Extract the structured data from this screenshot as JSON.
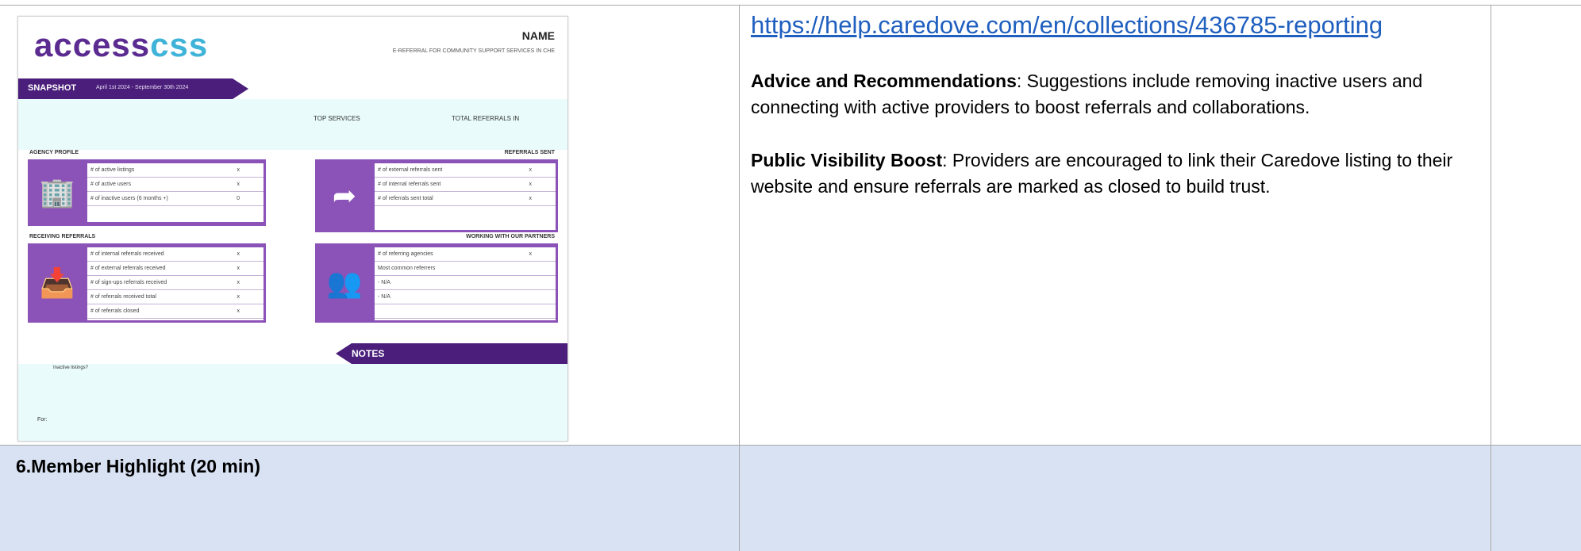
{
  "link": "https://help.caredove.com/en/collections/436785-reporting",
  "advice": {
    "heading": "Advice and Recommendations",
    "text": ": Suggestions include removing inactive users and connecting with active providers to boost referrals and collaborations."
  },
  "visibility": {
    "heading": "Public Visibility Boost",
    "text": ": Providers are encouraged to link their Caredove listing to their website and ensure referrals are marked as closed to build trust."
  },
  "row2_title": "6.Member Highlight (20 min)",
  "snapshot": {
    "logo_a": "access",
    "logo_b": "css",
    "name": "NAME",
    "subtitle": "E-REFERRAL FOR COMMUNITY SUPPORT SERVICES IN CHE",
    "banner_title": "SNAPSHOT",
    "banner_dates": "April 1st 2024 - September 30th 2024",
    "top_services": "TOP SERVICES",
    "total_referrals": "TOTAL REFERRALS IN",
    "agency_profile": "AGENCY PROFILE",
    "referrals_sent": "REFERRALS SENT",
    "receiving_referrals": "RECEIVING REFERRALS",
    "working_partners": "WORKING WITH OUR PARTNERS",
    "agency_rows": [
      {
        "label": "# of active listings",
        "value": "x"
      },
      {
        "label": "# of active users",
        "value": "x"
      },
      {
        "label": "# of inactive users (6 months +)",
        "value": "0"
      }
    ],
    "sent_rows": [
      {
        "label": "# of external referrals sent",
        "value": "x"
      },
      {
        "label": "# of internal referrals sent",
        "value": "x"
      },
      {
        "label": "# of referrals sent total",
        "value": "x"
      }
    ],
    "receiving_rows": [
      {
        "label": "# of internal referrals received",
        "value": "x"
      },
      {
        "label": "# of external referrals received",
        "value": "x"
      },
      {
        "label": "# of sign-ups referrals received",
        "value": "x"
      },
      {
        "label": "# of referrals received total",
        "value": "x"
      },
      {
        "label": "# of referrals closed",
        "value": "x"
      }
    ],
    "partner_rows": [
      {
        "label": "# of referring agencies",
        "value": "x"
      },
      {
        "label": "Most common referrers",
        "value": ""
      },
      {
        "label": "- N/A",
        "value": ""
      },
      {
        "label": "- N/A",
        "value": ""
      },
      {
        "label": "",
        "value": ""
      }
    ],
    "notes": "NOTES",
    "notes_line1": "Inactive listings?",
    "notes_line2": "For:"
  }
}
